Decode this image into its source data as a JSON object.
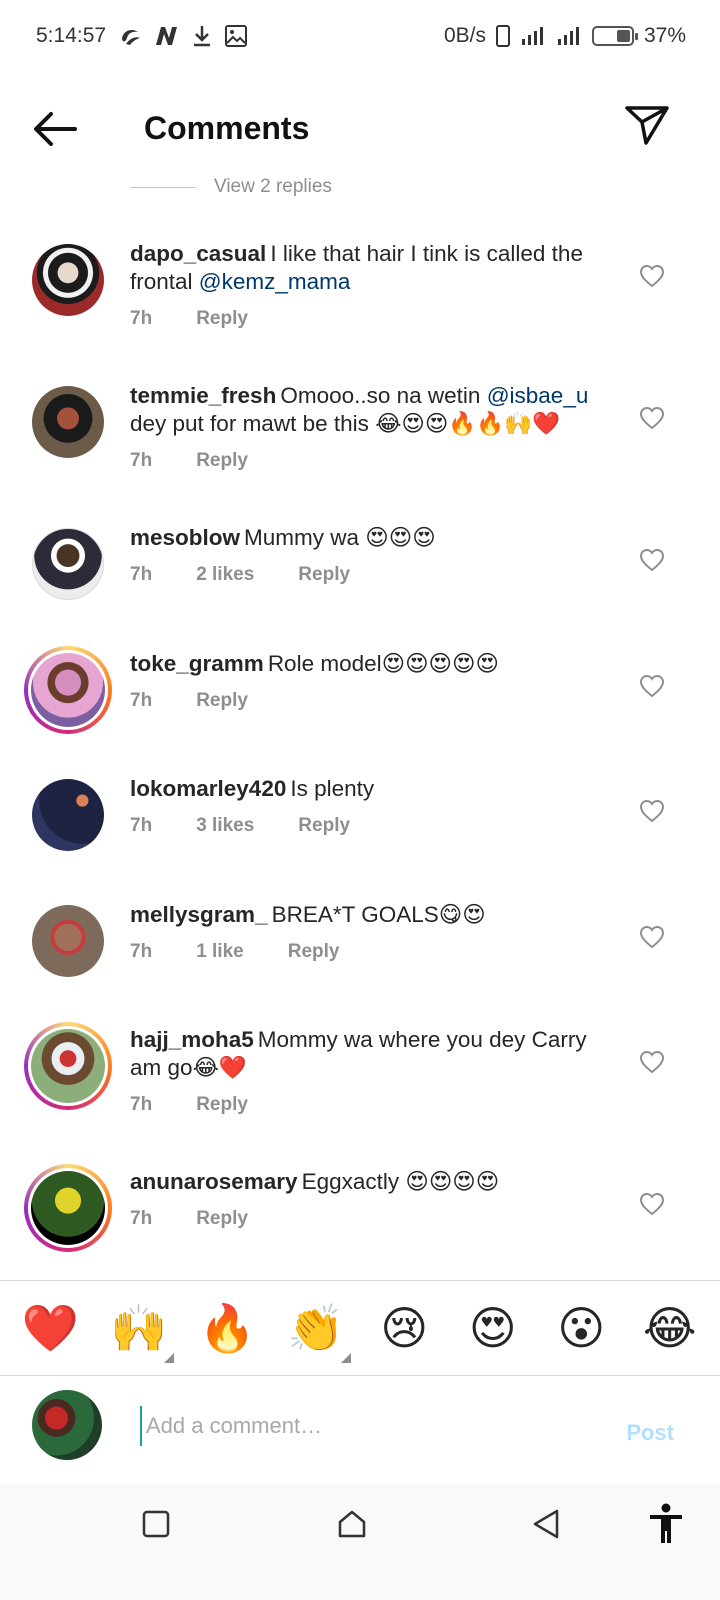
{
  "status_bar": {
    "time": "5:14:57",
    "net_speed": "0B/s",
    "battery": "37%",
    "battery_level": 0.37
  },
  "header": {
    "title": "Comments"
  },
  "view_replies": "View 2 replies",
  "comments": [
    {
      "user": "dapo_casual",
      "text": "I like that hair I tink is called the frontal ",
      "mention": "@kemz_mama",
      "time": "7h",
      "likes": "",
      "reply": "Reply",
      "avatar_color": "#7a4b3a",
      "story": false
    },
    {
      "user": "temmie_fresh",
      "text": "Omooo..so na wetin ",
      "mention": "@isbae_u",
      "text2": " dey put for mawt be this 😂😍😍🔥🔥🙌❤️",
      "time": "7h",
      "likes": "",
      "reply": "Reply",
      "avatar_color": "#5a4a38",
      "story": false
    },
    {
      "user": "mesoblow",
      "text": "Mummy wa 😍😍😍",
      "time": "7h",
      "likes": "2 likes",
      "reply": "Reply",
      "avatar_color": "#3a3a48",
      "story": false
    },
    {
      "user": "toke_gramm",
      "text": "Role model😍😍😍😍😍",
      "time": "7h",
      "likes": "",
      "reply": "Reply",
      "avatar_color": "#c77fb8",
      "story": true
    },
    {
      "user": "lokomarley420",
      "text": "Is plenty",
      "time": "7h",
      "likes": "3 likes",
      "reply": "Reply",
      "avatar_color": "#1d2340",
      "story": false
    },
    {
      "user": "mellysgram_",
      "text": "BREA*T GOALS😋😍",
      "time": "7h",
      "likes": "1 like",
      "reply": "Reply",
      "avatar_color": "#8c6a55",
      "story": false
    },
    {
      "user": "hajj_moha5",
      "text": "Mommy wa where you dey Carry am go😂❤️",
      "time": "7h",
      "likes": "",
      "reply": "Reply",
      "avatar_color": "#5c7d4f",
      "story": true
    },
    {
      "user": "anunarosemary",
      "text": "Eggxactly 😍😍😍😍",
      "time": "7h",
      "likes": "",
      "reply": "Reply",
      "avatar_color": "#2e5a22",
      "story": true
    }
  ],
  "emoji_bar": [
    "❤️",
    "🙌",
    "🔥",
    "👏",
    "😢",
    "😍",
    "😮",
    "😂"
  ],
  "add_comment": {
    "placeholder": "Add a comment…",
    "post_label": "Post"
  }
}
